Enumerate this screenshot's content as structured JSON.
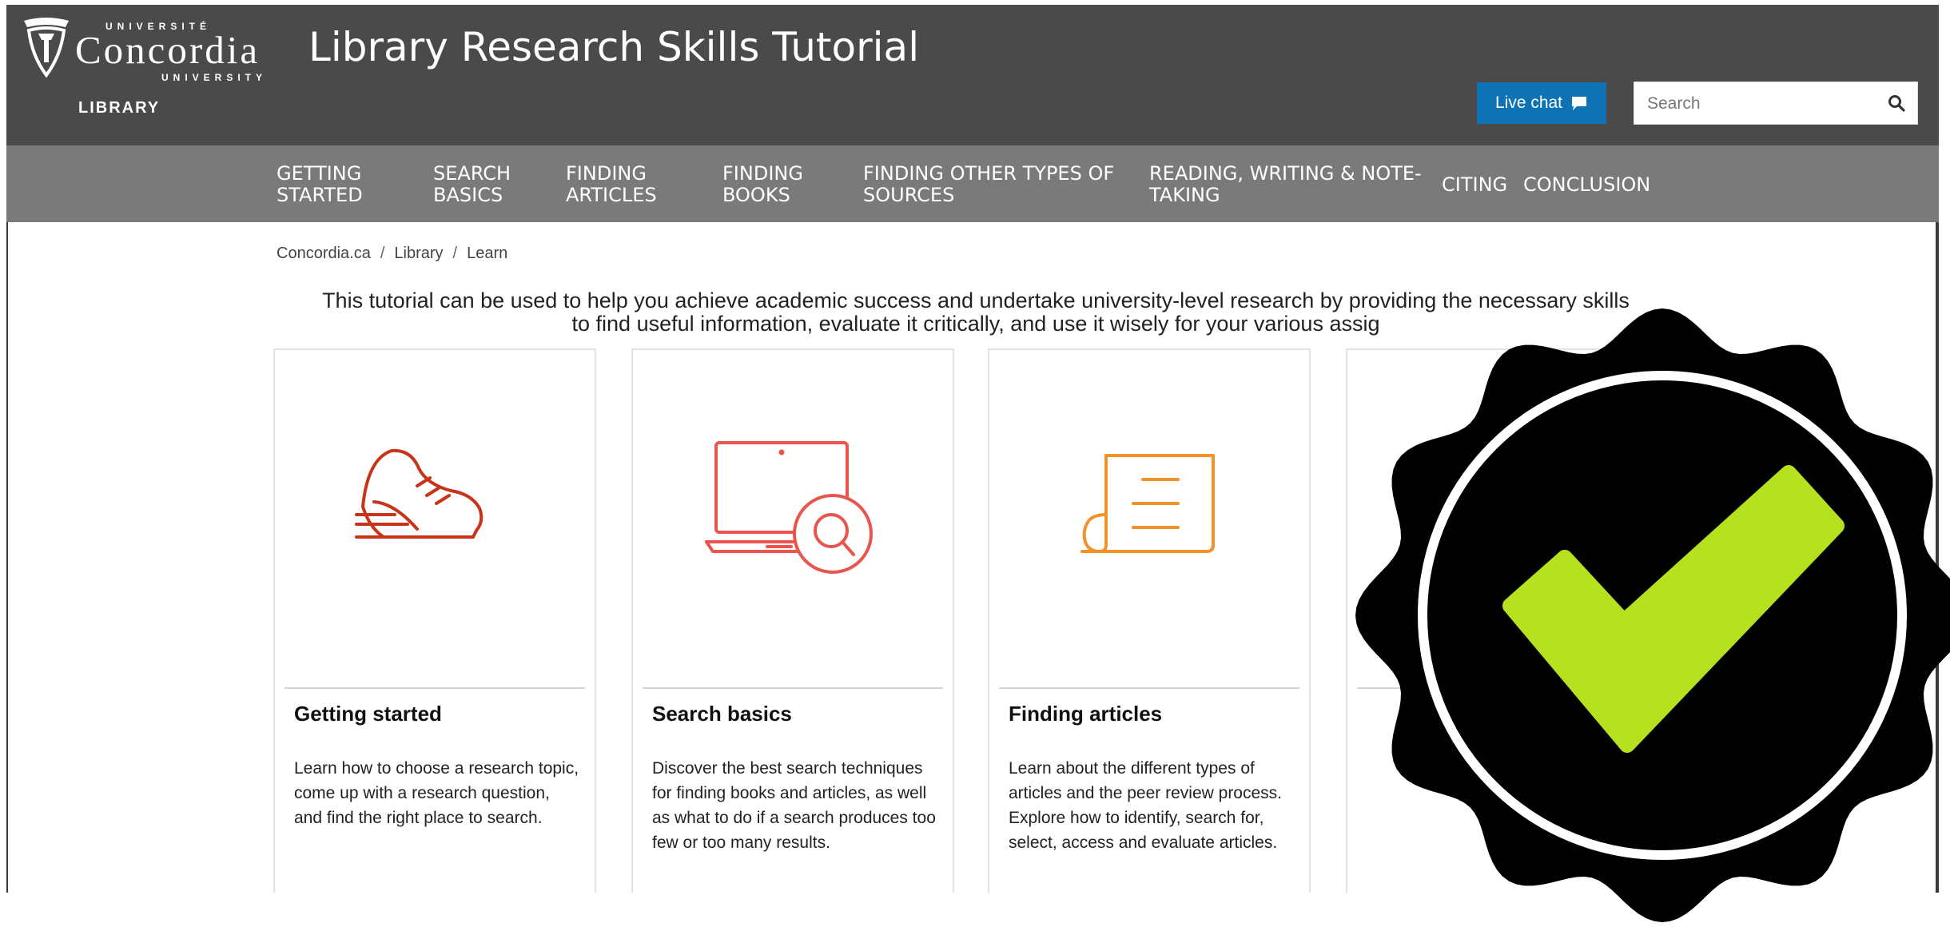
{
  "header": {
    "logo": {
      "universite": "UNIVERSITÉ",
      "wordmark": "Concordia",
      "university": "UNIVERSITY",
      "library": "LIBRARY"
    },
    "site_title": "Library Research Skills Tutorial",
    "live_chat_label": "Live chat",
    "search_placeholder": "Search"
  },
  "nav": {
    "items": [
      {
        "line1": "GETTING",
        "line2": "STARTED"
      },
      {
        "line1": "SEARCH",
        "line2": "BASICS"
      },
      {
        "line1": "FINDING",
        "line2": "ARTICLES"
      },
      {
        "line1": "FINDING",
        "line2": "BOOKS"
      },
      {
        "line1": "FINDING OTHER TYPES OF",
        "line2": "SOURCES"
      },
      {
        "line1": "READING, WRITING & NOTE-",
        "line2": "TAKING"
      },
      {
        "line1": "CITING",
        "line2": ""
      },
      {
        "line1": "CONCLUSION",
        "line2": ""
      }
    ]
  },
  "breadcrumb": [
    "Concordia.ca",
    "Library",
    "Learn"
  ],
  "intro": {
    "line1": "This tutorial can be used to help you achieve academic success and undertake university-level research by providing the necessary skills",
    "line2": "to find useful information, evaluate it critically, and use it wisely for your various assig"
  },
  "cards": [
    {
      "title": "Getting started",
      "text": "Learn how to choose a research topic, come up with a research question, and find the right place to search.",
      "icon": "sneaker-icon",
      "color": "#c8341a"
    },
    {
      "title": "Search basics",
      "text": "Discover the best search techniques for finding books and articles, as well as what to do if a search produces too few or too many results.",
      "icon": "laptop-search-icon",
      "color": "#e8554e"
    },
    {
      "title": "Finding articles",
      "text": "Learn about the different types of articles and the peer review process. Explore how to identify, search for, select, access and evaluate articles.",
      "icon": "document-scroll-icon",
      "color": "#f0932b"
    }
  ],
  "colors": {
    "header_bg": "#4a4a4a",
    "nav_bg": "#7a7a7a",
    "live_chat_bg": "#0e72b5",
    "badge_check": "#b5e11f"
  }
}
